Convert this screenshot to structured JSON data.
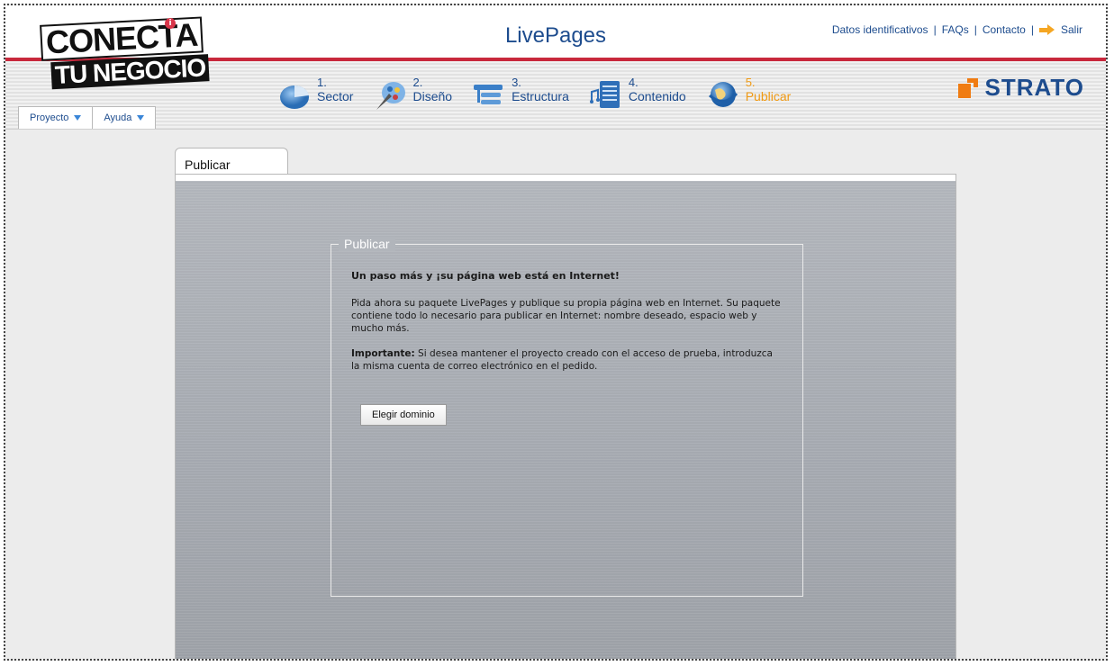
{
  "header": {
    "logo_line1": "CONECTA",
    "logo_line2": "TU NEGOCIO",
    "info_badge": "i",
    "app_title": "LivePages",
    "links": {
      "datos": "Datos identificativos",
      "faqs": "FAQs",
      "contacto": "Contacto",
      "salir": "Salir",
      "separator": "|"
    },
    "brand": "STRATO",
    "menus": [
      {
        "label": "Proyecto"
      },
      {
        "label": "Ayuda"
      }
    ],
    "steps": [
      {
        "num": "1.",
        "label": "Sector"
      },
      {
        "num": "2.",
        "label": "Diseño"
      },
      {
        "num": "3.",
        "label": "Estructura"
      },
      {
        "num": "4.",
        "label": "Contenido"
      },
      {
        "num": "5.",
        "label": "Publicar",
        "active": true
      }
    ]
  },
  "colors": {
    "accent_blue": "#1d4c8e",
    "active_orange": "#f09a14",
    "red_line": "#c8283c",
    "brand_orange": "#f07c12"
  },
  "main": {
    "tab_label": "Publicar",
    "section": {
      "legend": "Publicar",
      "headline": "Un paso más y ¡su página web está en Internet!",
      "paragraph1": "Pida ahora su paquete LivePages y publique su propia página web en Internet. Su paquete contiene todo lo necesario para publicar en Internet: nombre deseado, espacio web y mucho más.",
      "important_label": "Importante:",
      "important_text": " Si desea mantener el proyecto creado con el acceso de prueba, introduzca la misma cuenta de correo electrónico en el pedido.",
      "button_label": "Elegir dominio"
    }
  }
}
